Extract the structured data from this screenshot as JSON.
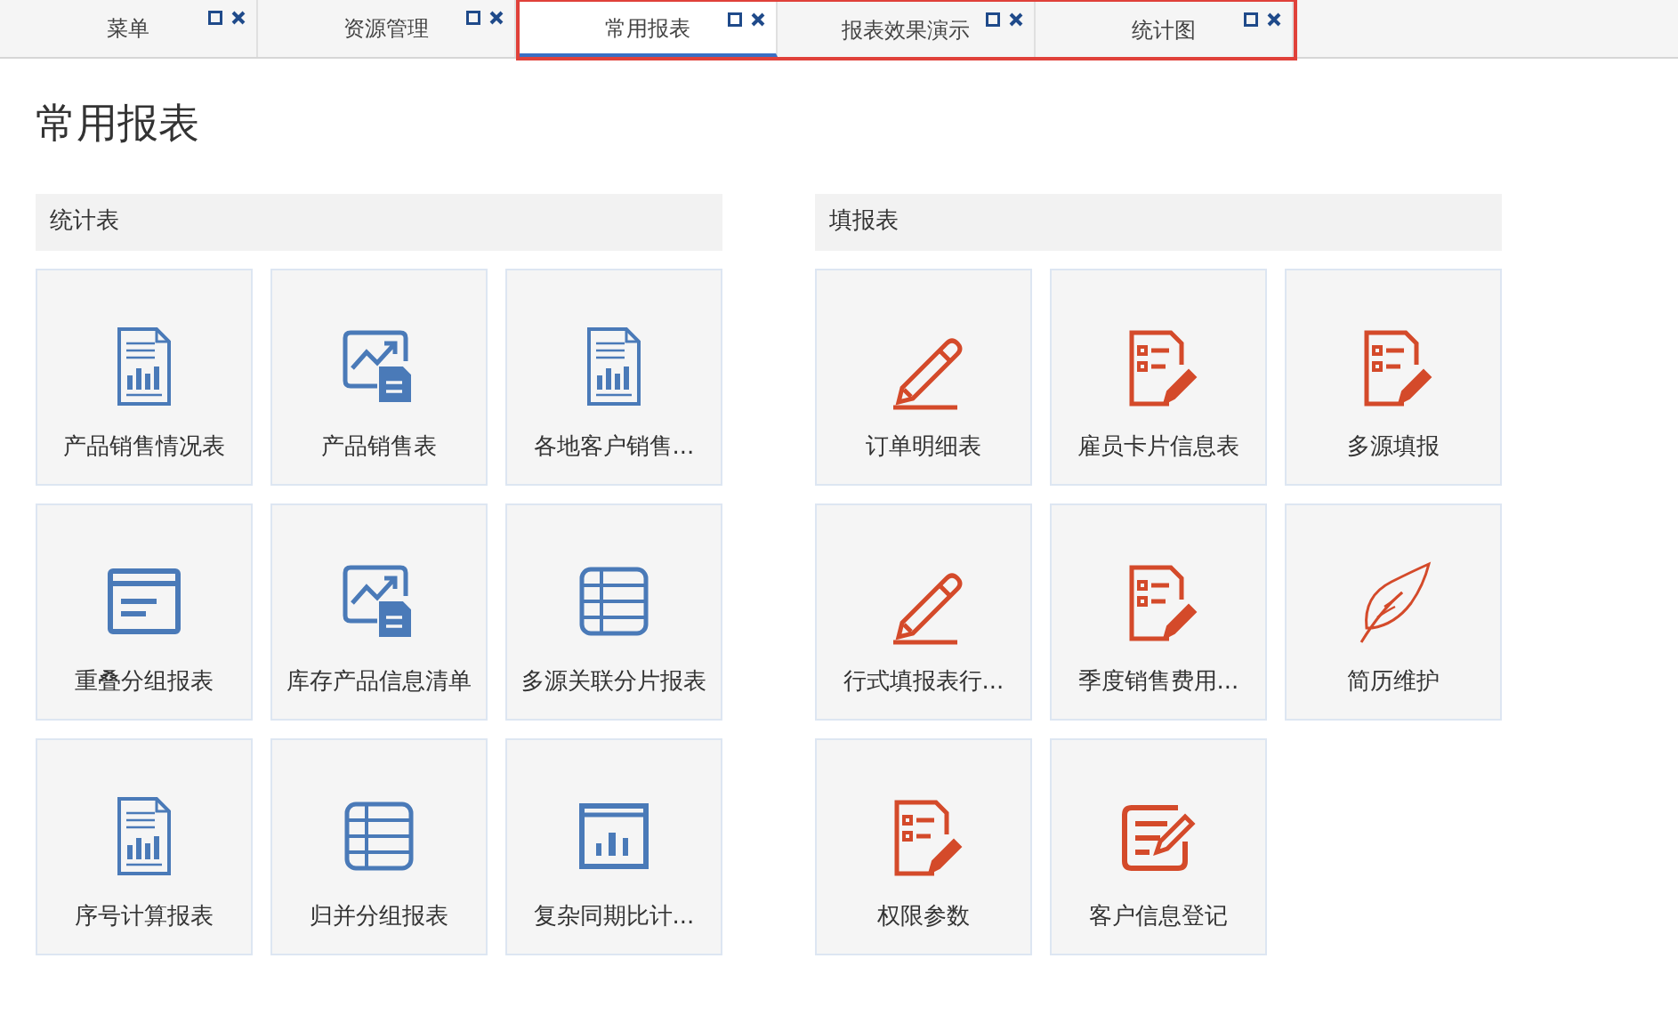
{
  "tabs": [
    {
      "label": "菜单",
      "selected": false,
      "highlighted": false
    },
    {
      "label": "资源管理",
      "selected": false,
      "highlighted": false
    },
    {
      "label": "常用报表",
      "selected": true,
      "highlighted": true
    },
    {
      "label": "报表效果演示",
      "selected": false,
      "highlighted": true
    },
    {
      "label": "统计图",
      "selected": false,
      "highlighted": true
    }
  ],
  "page_title": "常用报表",
  "sections": [
    {
      "title": "统计表",
      "color": "#4a7ab8",
      "cards": [
        {
          "label": "产品销售情况表",
          "kind": "doc-chart"
        },
        {
          "label": "产品销售表",
          "kind": "image-doc"
        },
        {
          "label": "各地客户销售...",
          "kind": "doc-chart"
        },
        {
          "label": "重叠分组报表",
          "kind": "window"
        },
        {
          "label": "库存产品信息清单",
          "kind": "image-doc"
        },
        {
          "label": "多源关联分片报表",
          "kind": "table"
        },
        {
          "label": "序号计算报表",
          "kind": "doc-chart"
        },
        {
          "label": "归并分组报表",
          "kind": "table"
        },
        {
          "label": "复杂同期比计...",
          "kind": "chart-window"
        }
      ]
    },
    {
      "title": "填报表",
      "color": "#d44a2a",
      "cards": [
        {
          "label": "订单明细表",
          "kind": "pencil"
        },
        {
          "label": "雇员卡片信息表",
          "kind": "form-edit"
        },
        {
          "label": "多源填报",
          "kind": "form-edit"
        },
        {
          "label": "行式填报表行...",
          "kind": "pencil"
        },
        {
          "label": "季度销售费用...",
          "kind": "form-edit"
        },
        {
          "label": "简历维护",
          "kind": "feather"
        },
        {
          "label": "权限参数",
          "kind": "form-edit"
        },
        {
          "label": "客户信息登记",
          "kind": "note-edit"
        }
      ]
    }
  ]
}
